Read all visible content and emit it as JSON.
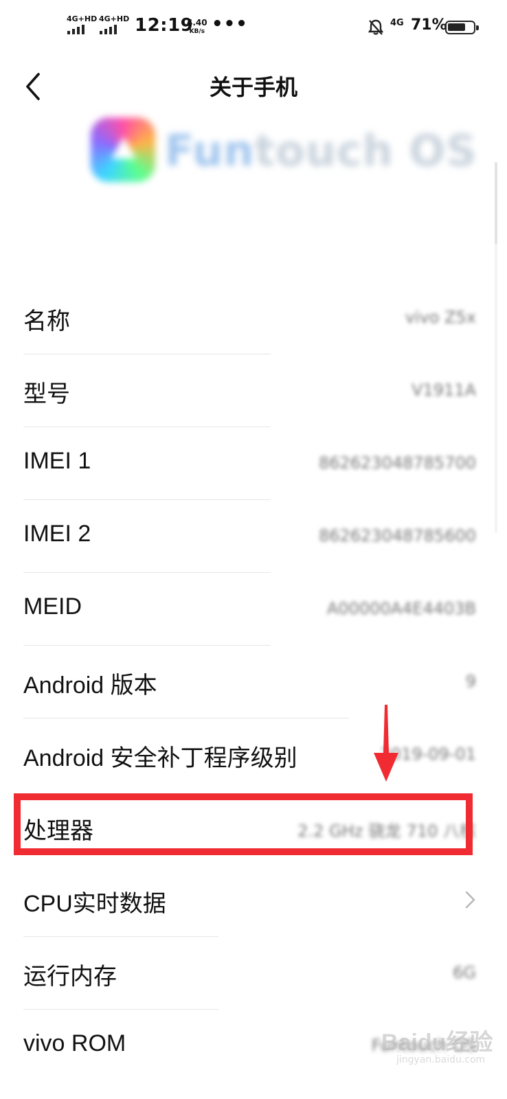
{
  "status_bar": {
    "signal1": "4G+HD",
    "signal2": "4G+HD",
    "time": "12:19",
    "speed_value": "4.40",
    "speed_unit": "KB/s",
    "more": "•••",
    "network": "4G",
    "battery_percent": "71%",
    "battery_level": 0.71
  },
  "header": {
    "title": "关于手机"
  },
  "logo": {
    "brand_fun": "Fun",
    "brand_rest": "touch OS"
  },
  "rows": [
    {
      "label": "名称",
      "value": "vivo Z5x"
    },
    {
      "label": "型号",
      "value": "V1911A"
    },
    {
      "label": "IMEI 1",
      "value": "862623048785700"
    },
    {
      "label": "IMEI 2",
      "value": "862623048785600"
    },
    {
      "label": "MEID",
      "value": "A00000A4E4403B"
    },
    {
      "label": "Android 版本",
      "value": "9"
    },
    {
      "label": "Android 安全补丁程序级别",
      "value": "2019-09-01"
    },
    {
      "label": "处理器",
      "value": "2.2 GHz 骁龙 710 八核"
    },
    {
      "label": "CPU实时数据",
      "value": ""
    },
    {
      "label": "运行内存",
      "value": "6G"
    },
    {
      "label": "vivo ROM",
      "value": "Funtouch OS"
    }
  ],
  "watermark": {
    "main": "Baidu经验",
    "sub": "jingyan.baidu.com"
  },
  "colors": {
    "highlight": "#f02c32",
    "background": "#ffffff"
  }
}
